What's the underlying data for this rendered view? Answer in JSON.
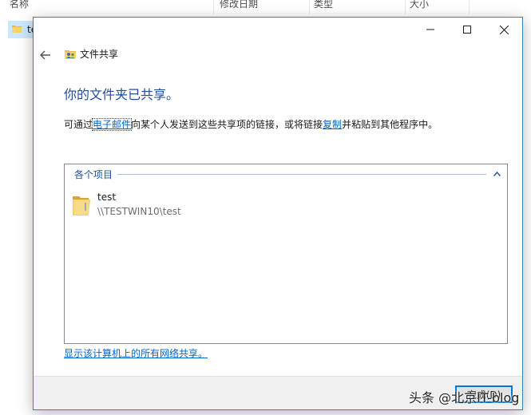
{
  "explorer": {
    "columns": [
      "名称",
      "修改日期",
      "类型",
      "大小"
    ],
    "row_name": "test"
  },
  "dialog": {
    "title": "文件共享",
    "heading": "你的文件夹已共享。",
    "desc_prefix": "可通过",
    "email_link": "电子邮件",
    "desc_middle": "向某个人发送到这些共享项的链接，或将链接",
    "copy_link": "复制",
    "desc_suffix": "并粘贴到其他程序中。",
    "group_label": "各个项目",
    "items": [
      {
        "name": "test",
        "path": "\\\\TESTWIN10\\test"
      }
    ],
    "network_link": "显示该计算机上的所有网络共享。",
    "done_button": "完成(D)"
  },
  "watermark": "头条 @北京IT-blog",
  "icons": {
    "back": "back-arrow-icon",
    "title": "file-sharing-icon",
    "folder": "folder-icon",
    "collapse": "chevron-up-icon",
    "minimize": "minimize-icon",
    "maximize": "maximize-icon",
    "close": "close-icon"
  },
  "colors": {
    "heading": "#1f4e9e",
    "link": "#0066cc",
    "dialog_border": "#3c7fb1",
    "footer": "#f0f0f0",
    "selection": "#cce8ff"
  }
}
